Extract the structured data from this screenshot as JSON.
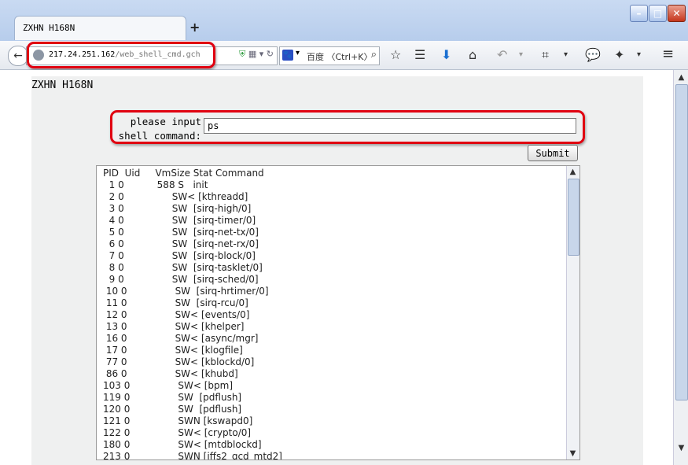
{
  "browser": {
    "tab_title": "ZXHN H168N",
    "newtab_label": "+",
    "url_host": "217.24.251.162",
    "url_path": "/web_shell_cmd.gch",
    "search_text": "百度 〈Ctrl+K〉",
    "annotation_color": "#e00010"
  },
  "page": {
    "heading": "ZXHN H168N",
    "prompt_label": "please input shell command:",
    "command_value": "ps",
    "submit_label": "Submit",
    "output_lines": [
      "PID  Uid     VmSize Stat Command",
      "  1 0           588 S   init",
      "  2 0                SW< [kthreadd]",
      "  3 0                SW  [sirq-high/0]",
      "  4 0                SW  [sirq-timer/0]",
      "  5 0                SW  [sirq-net-tx/0]",
      "  6 0                SW  [sirq-net-rx/0]",
      "  7 0                SW  [sirq-block/0]",
      "  8 0                SW  [sirq-tasklet/0]",
      "  9 0                SW  [sirq-sched/0]",
      " 10 0                SW  [sirq-hrtimer/0]",
      " 11 0                SW  [sirq-rcu/0]",
      " 12 0                SW< [events/0]",
      " 13 0                SW< [khelper]",
      " 16 0                SW< [async/mgr]",
      " 17 0                SW< [klogfile]",
      " 77 0                SW< [kblockd/0]",
      " 86 0                SW< [khubd]",
      "103 0                SW< [bpm]",
      "119 0                SW  [pdflush]",
      "120 0                SW  [pdflush]",
      "121 0                SWN [kswapd0]",
      "122 0                SW< [crypto/0]",
      "180 0                SW< [mtdblockd]",
      "213 0                SWN [jffs2_gcd_mtd2]"
    ]
  }
}
